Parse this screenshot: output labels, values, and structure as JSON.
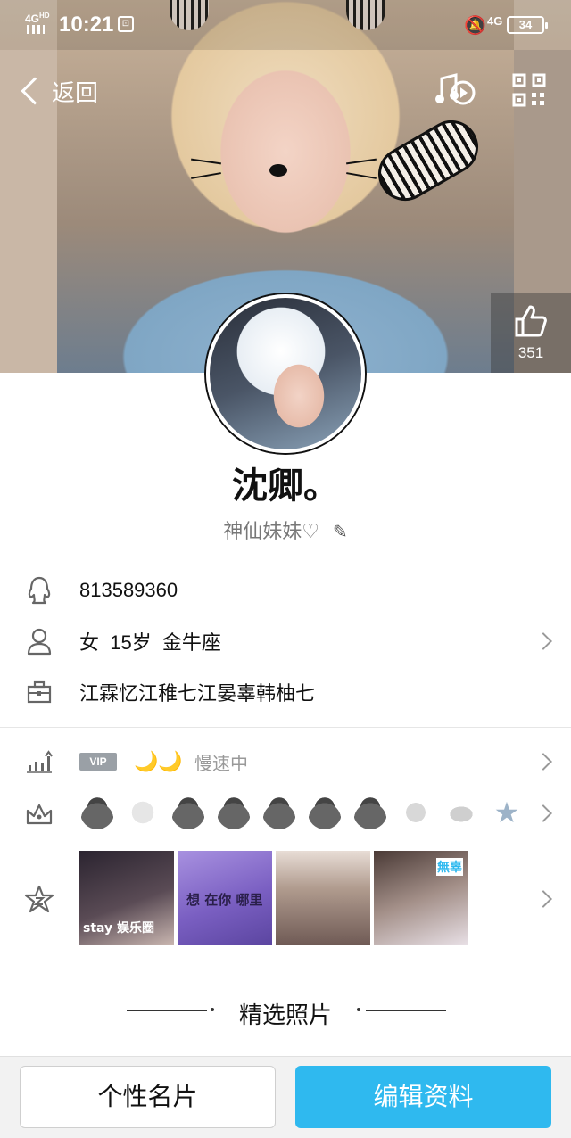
{
  "status_bar": {
    "network": "4G",
    "network_sup": "HD",
    "time": "10:21",
    "mobile_tag": "4G",
    "battery": "34"
  },
  "nav": {
    "back_label": "返回",
    "like_count": "351"
  },
  "profile": {
    "nickname": "沈卿。",
    "signature": "神仙妹妹♡"
  },
  "info": {
    "qq_number": "813589360",
    "gender_age_sign": "女  15岁  金牛座",
    "company": "江霖忆江稚七江晏辜韩柚七"
  },
  "vip": {
    "badge": "VIP",
    "moons": "🌙🌙",
    "status": "慢速中"
  },
  "medals": [
    "penguin",
    "diamond-lv",
    "penguin-green",
    "penguin-green2",
    "penguin-fish",
    "penguin-pink",
    "penguin-crown",
    "diamond",
    "cloud-v",
    "star"
  ],
  "thumbnails": [
    {
      "caption": "stay 娱乐圈",
      "color": "#3a3340"
    },
    {
      "caption": "想 在你 哪里",
      "color": "#7a5fc2"
    },
    {
      "caption": "",
      "color": "#b09b8e"
    },
    {
      "caption": "無辜",
      "color": "#4a3a36"
    }
  ],
  "section": {
    "photos_title": "精选照片"
  },
  "bottom": {
    "card_label": "个性名片",
    "edit_label": "编辑资料"
  },
  "colors": {
    "accent": "#2fb9ef",
    "vip_grey": "#9aa0a6",
    "moon": "#f2b400"
  }
}
